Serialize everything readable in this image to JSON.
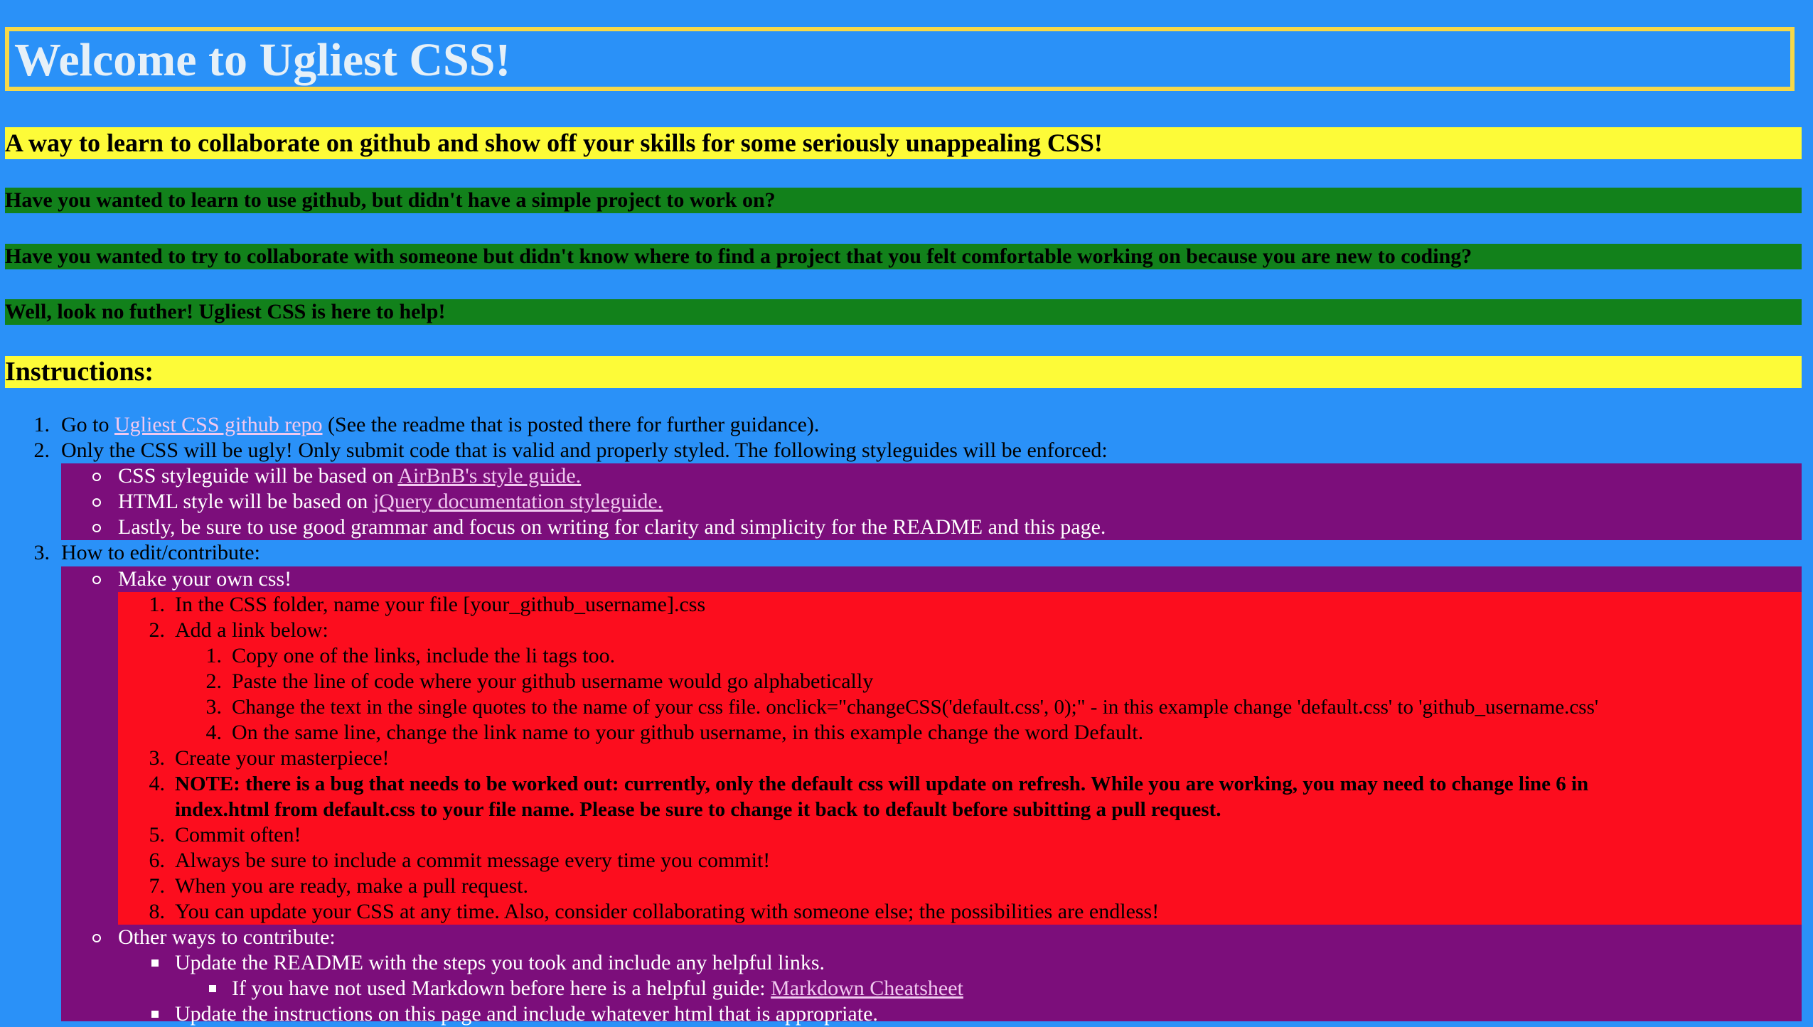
{
  "header": {
    "title": "Welcome to Ugliest CSS!"
  },
  "intro": {
    "tagline": "A way to learn to collaborate on github and show off your skills for some seriously unappealing CSS!",
    "q1": "Have you wanted to learn to use github, but didn't have a simple project to work on?",
    "q2": "Have you wanted to try to collaborate with someone but didn't know where to find a project that you felt comfortable working on because you are new to coding?",
    "q3": "Well, look no futher! Ugliest CSS is here to help!"
  },
  "instructions": {
    "heading": "Instructions:",
    "step1": {
      "num": "1.",
      "prefix": "Go to ",
      "link": "Ugliest CSS github repo",
      "suffix": " (See the readme that is posted there for further guidance)."
    },
    "step2": {
      "num": "2.",
      "text": "Only the CSS will be ugly! Only submit code that is valid and properly styled. The following styleguides will be enforced:",
      "css_prefix": "CSS styleguide will be based on ",
      "css_link": "AirBnB's style guide.",
      "html_prefix": "HTML style will be based on ",
      "html_link": "jQuery documentation styleguide.",
      "lastly": "Lastly, be sure to use good grammar and focus on writing for clarity and simplicity for the README and this page."
    },
    "step3": {
      "num": "3.",
      "text": "How to edit/contribute:",
      "make_own": "Make your own css!",
      "sub": [
        {
          "num": "1.",
          "text": "In the CSS folder, name your file [your_github_username].css"
        },
        {
          "num": "2.",
          "text": "Add a link below:"
        },
        {
          "num": "3.",
          "text": "Create your masterpiece!"
        },
        {
          "num": "4.",
          "text": "NOTE: there is a bug that needs to be worked out: currently, only the default css will update on refresh. While you are working, you may need to change line 6 in",
          "text2": "index.html from default.css to your file name. Please be sure to change it back to default before subitting a pull request."
        },
        {
          "num": "5.",
          "text": "Commit often!"
        },
        {
          "num": "6.",
          "text": "Always be sure to include a commit message every time you commit!"
        },
        {
          "num": "7.",
          "text": "When you are ready, make a pull request."
        },
        {
          "num": "8.",
          "text": "You can update your CSS at any time. Also, consider collaborating with someone else; the possibilities are endless!"
        }
      ],
      "link_steps": [
        {
          "num": "1.",
          "text": "Copy one of the links, include the li tags too."
        },
        {
          "num": "2.",
          "text": "Paste the line of code where your github username would go alphabetically"
        },
        {
          "num": "3.",
          "text": "Change the text in the single quotes to the name of your css file. onclick=\"changeCSS('default.css', 0);\" - in this example change 'default.css' to 'github_username.css'"
        },
        {
          "num": "4.",
          "text": "On the same line, change the link name to your github username, in this example change the word Default."
        }
      ],
      "other_ways": "Other ways to contribute:",
      "readme": "Update the README with the steps you took and include any helpful links.",
      "markdown_prefix": "If you have not used Markdown before here is a helpful guide: ",
      "markdown_link": "Markdown Cheatsheet",
      "update_instructions": "Update the instructions on this page and include whatever html that is appropriate."
    }
  },
  "colors": {
    "background": "#2a91f8",
    "title_border": "#f7d848",
    "yellow_band": "#fdfb38",
    "green_band": "#12811b",
    "purple_block": "#7c0e7b",
    "red_block": "#fc0d1e",
    "link": "#f0c8ef"
  }
}
